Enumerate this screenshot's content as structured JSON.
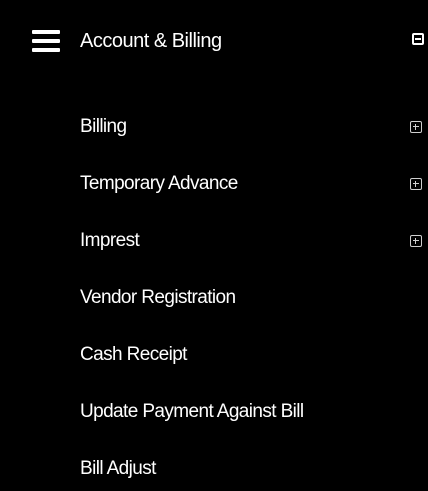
{
  "menu": {
    "header": {
      "label": "Account & Billing",
      "menu_icon": "hamburger-menu-icon",
      "toggle_icon": "collapse-minus-box-icon"
    },
    "items": [
      {
        "label": "Billing",
        "expandable": true,
        "icon": "expand-plus-box-icon"
      },
      {
        "label": "Temporary Advance",
        "expandable": true,
        "icon": "expand-plus-box-icon"
      },
      {
        "label": "Imprest",
        "expandable": true,
        "icon": "expand-plus-box-icon"
      },
      {
        "label": "Vendor Registration",
        "expandable": false
      },
      {
        "label": "Cash Receipt",
        "expandable": false
      },
      {
        "label": "Update Payment Against Bill",
        "expandable": false
      },
      {
        "label": "Bill Adjust",
        "expandable": false
      }
    ]
  },
  "colors": {
    "background": "#000000",
    "text": "#ffffff",
    "expand_icon": "#cfcfcf"
  }
}
